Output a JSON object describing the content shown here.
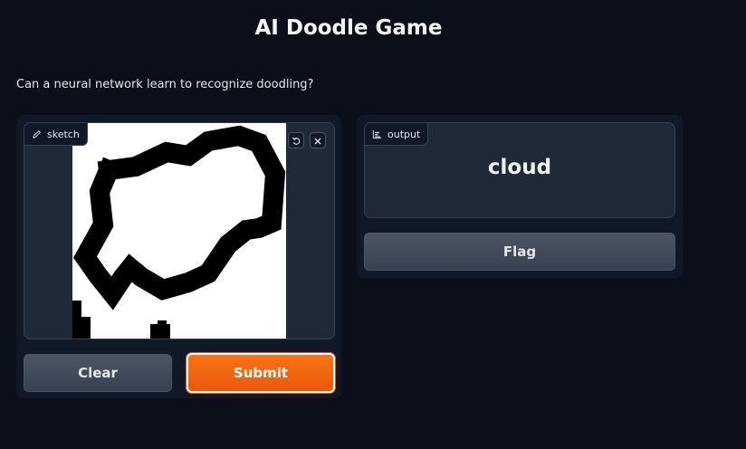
{
  "header": {
    "title": "AI Doodle Game",
    "description": "Can a neural network learn to recognize doodling?"
  },
  "sketch": {
    "label": "sketch",
    "label_icon": "pencil-icon",
    "undo_icon": "undo-icon",
    "close_icon": "close-icon"
  },
  "actions": {
    "clear_label": "Clear",
    "submit_label": "Submit"
  },
  "output": {
    "label": "output",
    "label_icon": "bar-chart-icon",
    "prediction": "cloud",
    "flag_label": "Flag"
  },
  "colors": {
    "background": "#0b0f19",
    "panel": "#111827",
    "block": "#1f2937",
    "accent": "#f97316"
  }
}
